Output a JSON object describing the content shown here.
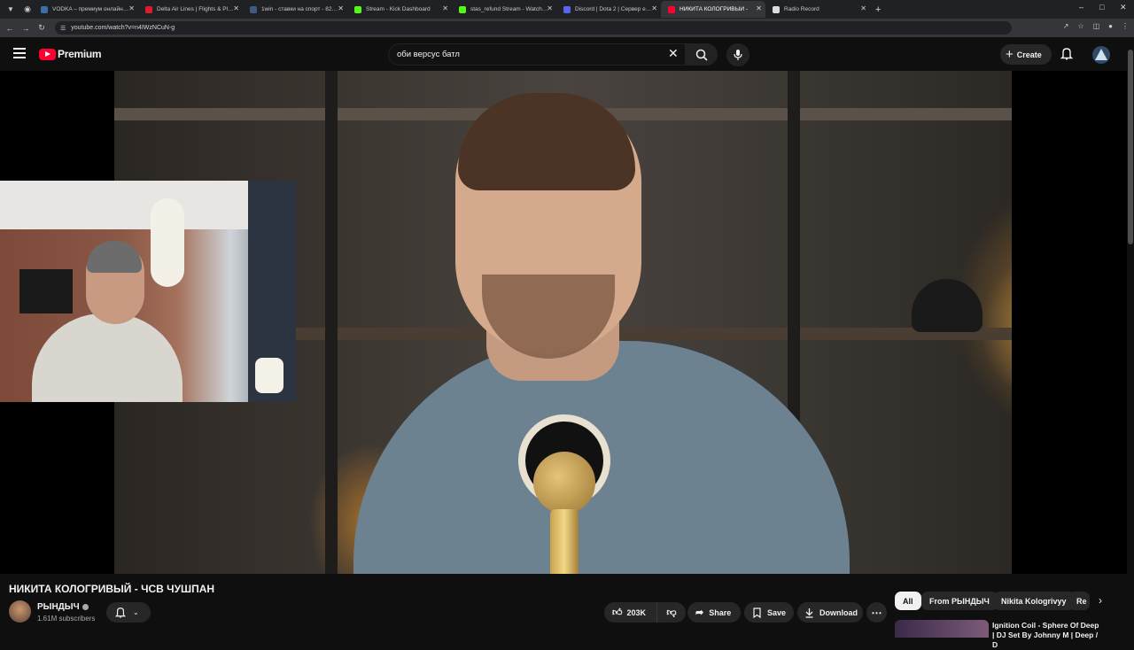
{
  "browser": {
    "tabs": [
      {
        "title": "VODKA – премиум онлайн-ка",
        "favicon_color": "#3a6ea5"
      },
      {
        "title": "Delta Air Lines | Flights & Plane",
        "favicon_color": "#e01933"
      },
      {
        "title": "1win - ставки на спорт - 82180",
        "favicon_color": "#3d5a80"
      },
      {
        "title": "Stream - Kick Dashboard",
        "favicon_color": "#53fc18"
      },
      {
        "title": "stas_refund Stream - Watch Live",
        "favicon_color": "#53fc18"
      },
      {
        "title": "Discord | Dota 2 | Сервер e[L]v",
        "favicon_color": "#5865f2"
      },
      {
        "title": "НИКИТА КОЛОГРИВЫЙ -",
        "favicon_color": "#ff0033"
      },
      {
        "title": "Radio Record",
        "favicon_color": "#dddddd"
      }
    ],
    "active_tab": 6,
    "url": "youtube.com/watch?v=n4IWzNCuN-g"
  },
  "header": {
    "logo_text": "Premium",
    "search_value": "оби версус батл",
    "create_label": "Create"
  },
  "video": {
    "title": "НИКИТА КОЛОГРИВЫЙ - ЧСВ ЧУШПАН"
  },
  "channel": {
    "name": "РЫНДЫЧ",
    "subscribers": "1.61M subscribers"
  },
  "actions": {
    "likes": "203K",
    "share": "Share",
    "save": "Save",
    "download": "Download"
  },
  "chips": [
    "All",
    "From РЫНДЫЧ",
    "Nikita Kologrivyy",
    "Re"
  ],
  "recommendation": {
    "title": "Ignition Coil - Sphere Of Deep | DJ Set By Johnny M | Deep / D"
  },
  "colors": {
    "background": "#0f0f0f",
    "brand_red": "#ff0033",
    "pill": "#272727"
  }
}
